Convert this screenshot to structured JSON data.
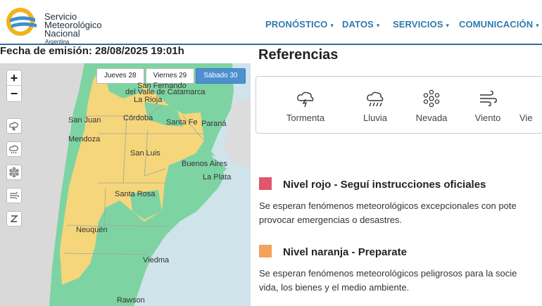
{
  "header": {
    "logo_line1": "Servicio",
    "logo_line2": "Meteorológico",
    "logo_line3": "Nacional",
    "logo_line4": "Argentina",
    "nav": [
      {
        "label": "PRONÓSTICO"
      },
      {
        "label": "DATOS"
      },
      {
        "label": "SERVICIOS"
      },
      {
        "label": "COMUNICACIÓN"
      }
    ]
  },
  "emision": "Fecha de emisión: 28/08/2025 19:01h",
  "map": {
    "zoom_in": "+",
    "zoom_out": "−",
    "days": [
      {
        "label": "Jueves 28",
        "active": false
      },
      {
        "label": "Viernes 29",
        "active": false
      },
      {
        "label": "Sábado 30",
        "active": true
      }
    ],
    "places": [
      "San Fernando",
      "del Valle de Catamarca",
      "La Rioja",
      "San Juan",
      "Córdoba",
      "Santa Fe",
      "Paraná",
      "Mendoza",
      "San Luis",
      "Buenos Aires",
      "La Plata",
      "Santa Rosa",
      "Neuquén",
      "Viedma",
      "Rawson"
    ],
    "colors": {
      "yellow": "#f6d67b",
      "green": "#7ed3a3",
      "water": "#cfe3ea"
    }
  },
  "referencias": {
    "title": "Referencias",
    "items": [
      {
        "label": "Tormenta",
        "icon": "storm-icon"
      },
      {
        "label": "Lluvia",
        "icon": "rain-icon"
      },
      {
        "label": "Nevada",
        "icon": "snow-icon"
      },
      {
        "label": "Viento",
        "icon": "wind-icon"
      },
      {
        "label": "Vie",
        "icon": "partial-icon"
      }
    ]
  },
  "niveles": [
    {
      "color": "#e0566a",
      "title": "Nivel rojo - Seguí instrucciones oficiales",
      "desc1": "Se esperan fenómenos meteorológicos excepcionales con pote",
      "desc2": "provocar emergencias o desastres."
    },
    {
      "color": "#f4a15a",
      "title": "Nivel naranja - Preparate",
      "desc1": "Se esperan fenómenos meteorológicos peligrosos para la socie",
      "desc2": "vida, los bienes y el medio ambiente."
    }
  ]
}
